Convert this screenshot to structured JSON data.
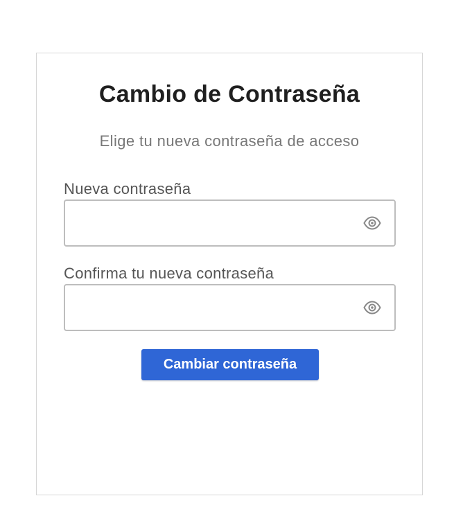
{
  "form": {
    "title": "Cambio de Contraseña",
    "subtitle": "Elige tu nueva contraseña de acceso",
    "fields": [
      {
        "label": "Nueva contraseña",
        "value": "",
        "placeholder": "",
        "icon": "eye-icon"
      },
      {
        "label": "Confirma tu nueva contraseña",
        "value": "",
        "placeholder": "",
        "icon": "eye-icon"
      }
    ],
    "submit_label": "Cambiar contraseña"
  },
  "colors": {
    "accent": "#2f66d6",
    "title": "#1f1f1f",
    "subtitle": "#777777",
    "label": "#555555",
    "border": "#bdbdbd"
  }
}
